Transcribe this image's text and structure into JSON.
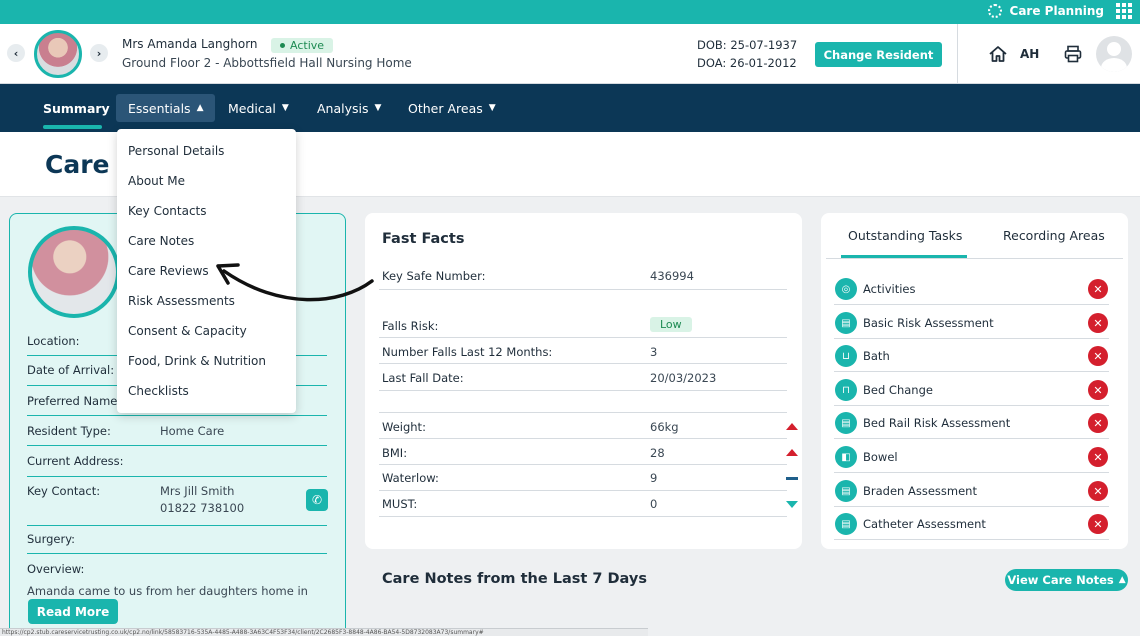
{
  "app": {
    "name": "Care Planning"
  },
  "resident": {
    "name": "Mrs Amanda Langhorn",
    "status": "Active",
    "location": "Ground Floor 2 - Abbottsfield Hall Nursing Home",
    "dob": "DOB: 25-07-1937",
    "doa": "DOA: 26-01-2012",
    "change_label": "Change Resident",
    "prev": "‹",
    "next": "›"
  },
  "user": {
    "initials": "AH"
  },
  "nav": {
    "items": [
      {
        "label": "Summary"
      },
      {
        "label": "Essentials"
      },
      {
        "label": "Medical"
      },
      {
        "label": "Analysis"
      },
      {
        "label": "Other Areas"
      }
    ]
  },
  "page": {
    "title": "Care S"
  },
  "dropdown": {
    "items": [
      "Personal Details",
      "About Me",
      "Key Contacts",
      "Care Notes",
      "Care Reviews",
      "Risk Assessments",
      "Consent & Capacity",
      "Food, Drink & Nutrition",
      "Checklists"
    ]
  },
  "profile": {
    "fields": [
      {
        "label": "Location:",
        "value": ""
      },
      {
        "label": "Date of Arrival:",
        "value": ""
      },
      {
        "label": "Preferred Name",
        "value": ""
      },
      {
        "label": "Resident Type:",
        "value": "Home Care"
      },
      {
        "label": "Current Address:",
        "value": ""
      },
      {
        "label": "Key Contact:",
        "value": "Mrs Jill Smith",
        "value2": "01822 738100"
      },
      {
        "label": "Surgery:",
        "value": ""
      },
      {
        "label": "Overview:",
        "value": ""
      }
    ],
    "overview_text": "Amanda came to us from her daughters home in",
    "read_more": "Read More"
  },
  "fast_facts": {
    "title": "Fast Facts",
    "key_safe": {
      "label": "Key Safe Number:",
      "value": "436994"
    },
    "falls_risk": {
      "label": "Falls Risk:",
      "value": "Low"
    },
    "falls_count": {
      "label": "Number Falls Last 12 Months:",
      "value": "3"
    },
    "last_fall": {
      "label": "Last Fall Date:",
      "value": "20/03/2023"
    },
    "weight": {
      "label": "Weight:",
      "value": "66kg",
      "trend": "up"
    },
    "bmi": {
      "label": "BMI:",
      "value": "28",
      "trend": "up"
    },
    "waterlow": {
      "label": "Waterlow:",
      "value": "9",
      "trend": "flat"
    },
    "must": {
      "label": "MUST:",
      "value": "0",
      "trend": "down"
    }
  },
  "tasks": {
    "tabs": [
      "Outstanding Tasks",
      "Recording Areas"
    ],
    "items": [
      {
        "label": "Activities",
        "icon": "activities-icon"
      },
      {
        "label": "Basic Risk Assessment",
        "icon": "clipboard-icon"
      },
      {
        "label": "Bath",
        "icon": "bath-icon"
      },
      {
        "label": "Bed Change",
        "icon": "bed-icon"
      },
      {
        "label": "Bed Rail Risk Assessment",
        "icon": "clipboard-icon"
      },
      {
        "label": "Bowel",
        "icon": "bowel-icon"
      },
      {
        "label": "Braden Assessment",
        "icon": "clipboard-icon"
      },
      {
        "label": "Catheter Assessment",
        "icon": "clipboard-icon"
      }
    ]
  },
  "care_notes": {
    "title": "Care Notes from the Last 7 Days",
    "view_label": "View Care Notes"
  },
  "status_url": "https://cp2.stub.careservicetrusting.co.uk/cp2.no/link/58583716-535A-4485-A488-3A63C4F53F34/client/2C2685F3-8848-4A86-BA54-5D8732083A73/summary#",
  "colors": {
    "brand": "#1ab5ad",
    "nav": "#0c3756",
    "alert": "#d41f2d"
  }
}
